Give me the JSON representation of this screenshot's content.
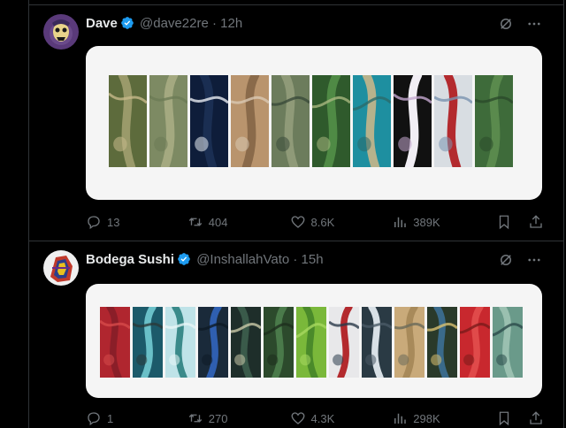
{
  "posts": [
    {
      "name": "Dave",
      "handle": "@dave22re",
      "separator": "·",
      "time": "12h",
      "avatar_icon": "skeletor-avatar",
      "stats": {
        "replies": "13",
        "reposts": "404",
        "likes": "8.6K",
        "views": "389K"
      },
      "tiles": [
        {
          "icon": "satellite-tile-farmland",
          "colors": [
            "#5d6b3c",
            "#9a9a6a",
            "#c7b98a"
          ]
        },
        {
          "icon": "satellite-tile-grassland",
          "colors": [
            "#7d8a63",
            "#a4a980",
            "#6b7a55"
          ]
        },
        {
          "icon": "satellite-tile-ice-ring-ocean",
          "colors": [
            "#0e1d3a",
            "#1a2e52",
            "#e8ecf2"
          ]
        },
        {
          "icon": "satellite-tile-canyon",
          "colors": [
            "#b9946d",
            "#8a6a4a",
            "#d9c8b3"
          ]
        },
        {
          "icon": "satellite-tile-lake",
          "colors": [
            "#6c7c5c",
            "#8f9a78",
            "#3a4a3a"
          ]
        },
        {
          "icon": "satellite-tile-river-forest",
          "colors": [
            "#2f5a2c",
            "#4f8a45",
            "#a7b780"
          ]
        },
        {
          "icon": "satellite-tile-delta",
          "colors": [
            "#1e8fa0",
            "#b6b28c",
            "#2b6a6a"
          ]
        },
        {
          "icon": "satellite-tile-snow-dark",
          "colors": [
            "#111111",
            "#f1eef4",
            "#c4a8d0"
          ]
        },
        {
          "icon": "satellite-tile-ice-red",
          "colors": [
            "#d8dde2",
            "#b32a2e",
            "#7a94b0"
          ]
        },
        {
          "icon": "satellite-tile-forest-road",
          "colors": [
            "#3e6b3a",
            "#5a8a4d",
            "#2a4a2a"
          ]
        }
      ]
    },
    {
      "name": "Bodega Sushi",
      "handle": "@InshallahVato",
      "separator": "·",
      "time": "15h",
      "avatar_icon": "graffiti-avatar",
      "stats": {
        "replies": "1",
        "reposts": "270",
        "likes": "4.3K",
        "views": "298K"
      },
      "tiles": [
        {
          "icon": "satellite-tile-red-field",
          "colors": [
            "#b0262f",
            "#8a1e28",
            "#d64a4a"
          ]
        },
        {
          "icon": "satellite-tile-teal-river",
          "colors": [
            "#1c5a6a",
            "#6ac0c8",
            "#2a3a3a"
          ]
        },
        {
          "icon": "satellite-tile-ice-channels",
          "colors": [
            "#bfe3e8",
            "#3a8a8a",
            "#e8f5f6"
          ]
        },
        {
          "icon": "satellite-tile-blue-loop",
          "colors": [
            "#1a2a3a",
            "#2f5fb0",
            "#0e1a26"
          ]
        },
        {
          "icon": "satellite-tile-dark-river",
          "colors": [
            "#1e2e2a",
            "#3a5a4a",
            "#c9c9a8"
          ]
        },
        {
          "icon": "satellite-tile-green-river",
          "colors": [
            "#2c4a2c",
            "#4a7a4a",
            "#1e2e1e"
          ]
        },
        {
          "icon": "satellite-tile-green-fields",
          "colors": [
            "#7ab83a",
            "#4a8a2a",
            "#a8d860"
          ]
        },
        {
          "icon": "satellite-tile-red-coast",
          "colors": [
            "#e8e8ea",
            "#b32a2e",
            "#2a3a4a"
          ]
        },
        {
          "icon": "satellite-tile-snow-meander",
          "colors": [
            "#2a3a44",
            "#d8e0e6",
            "#4a5a66"
          ]
        },
        {
          "icon": "satellite-tile-desert",
          "colors": [
            "#c9aa7a",
            "#a88a5a",
            "#6a6a5a"
          ]
        },
        {
          "icon": "satellite-tile-bay",
          "colors": [
            "#2a3a2a",
            "#3a6a8a",
            "#d8c070"
          ]
        },
        {
          "icon": "satellite-tile-red-forest",
          "colors": [
            "#c8282e",
            "#e04a4a",
            "#7a1a1a"
          ]
        },
        {
          "icon": "satellite-tile-swirl",
          "colors": [
            "#6a9a8a",
            "#9ac0b0",
            "#2a4a4a"
          ]
        }
      ]
    }
  ],
  "icons": {
    "verified": "verified-badge-icon",
    "grok": "grok-icon",
    "more": "more-icon",
    "reply": "reply-icon",
    "repost": "repost-icon",
    "like": "like-icon",
    "views": "views-icon",
    "bookmark": "bookmark-icon",
    "share": "share-icon"
  },
  "colors": {
    "accent": "#1d9bf0",
    "muted": "#71767b",
    "text": "#e7e9ea",
    "border": "#2f3336",
    "card": "#f5f5f5"
  }
}
